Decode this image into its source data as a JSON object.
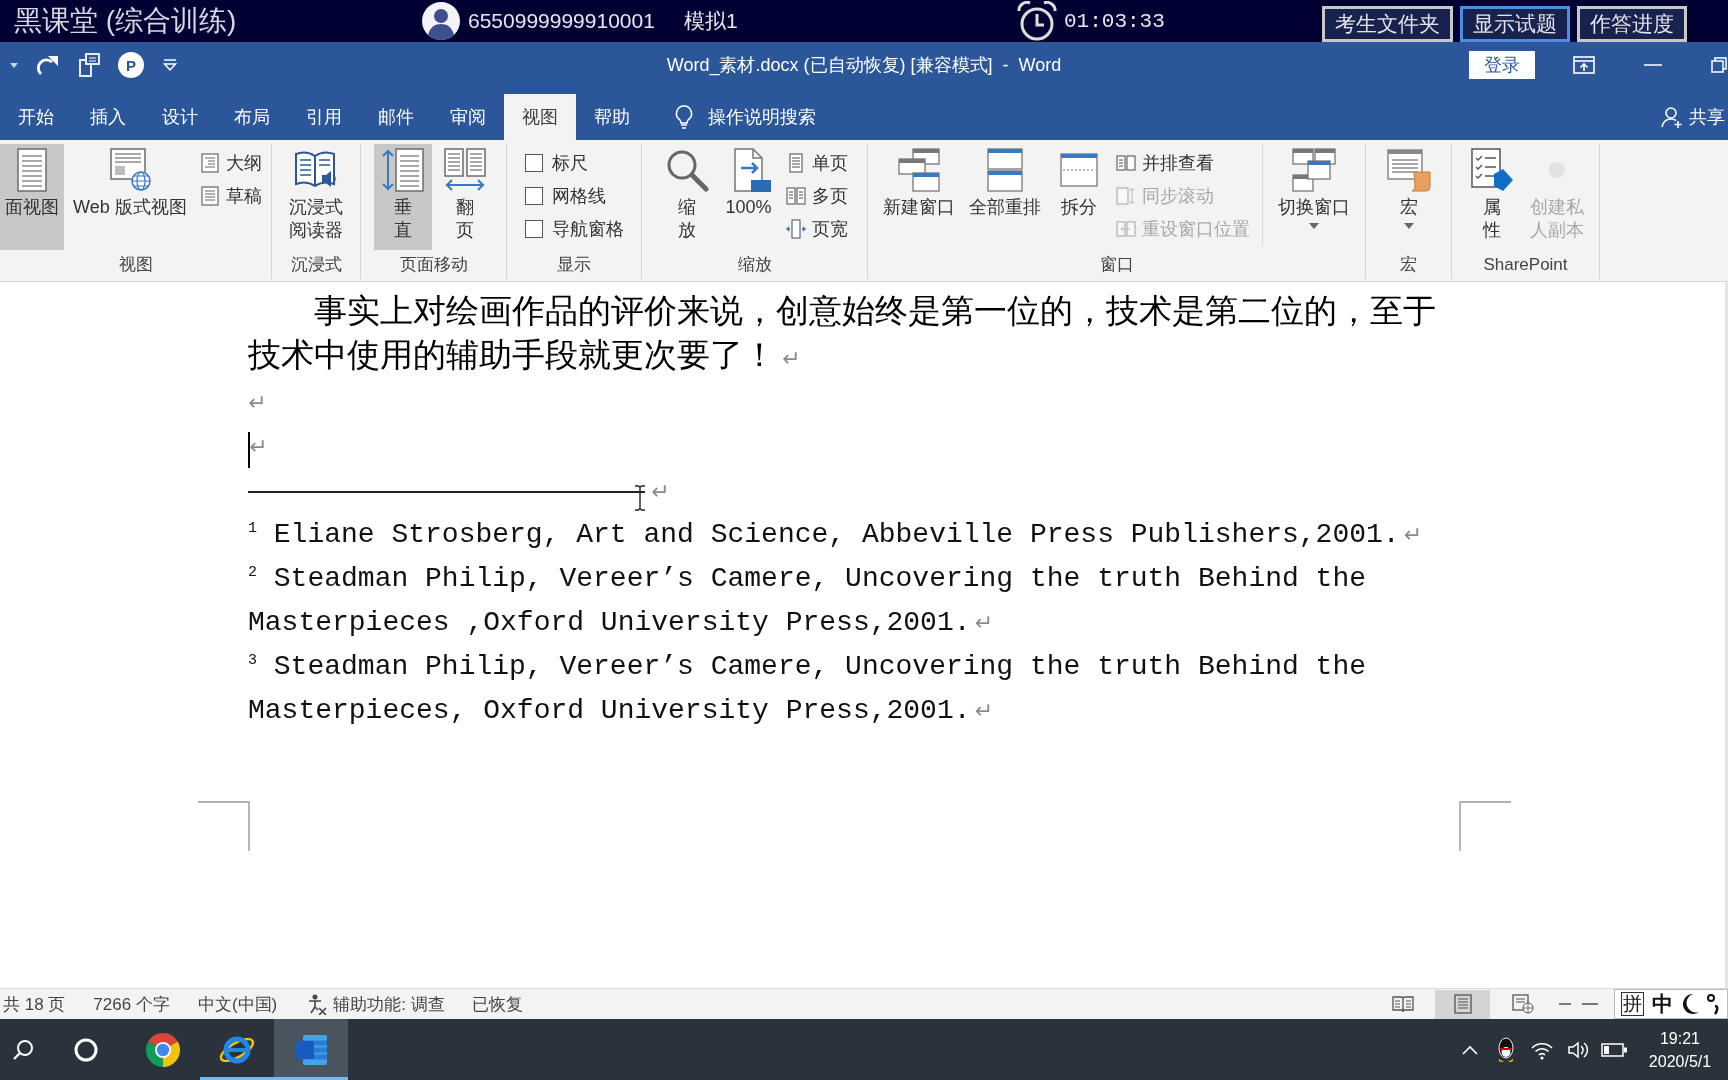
{
  "exam_bar": {
    "title": "黑课堂 (综合训练)",
    "candidate_id": "6550999999910001",
    "mode": "模拟1",
    "timer": "01:03:33",
    "buttons": [
      {
        "label": "考生文件夹",
        "selected": false
      },
      {
        "label": "显示试题",
        "selected": true
      },
      {
        "label": "作答进度",
        "selected": false
      }
    ]
  },
  "window": {
    "quick_access_badge": "P",
    "title": "Word_素材.docx (已自动恢复) [兼容模式]  -  Word",
    "sign_in": "登录"
  },
  "tabs": [
    {
      "label": "开始",
      "selected": false
    },
    {
      "label": "插入",
      "selected": false
    },
    {
      "label": "设计",
      "selected": false
    },
    {
      "label": "布局",
      "selected": false
    },
    {
      "label": "引用",
      "selected": false
    },
    {
      "label": "邮件",
      "selected": false
    },
    {
      "label": "审阅",
      "selected": false
    },
    {
      "label": "视图",
      "selected": true
    },
    {
      "label": "帮助",
      "selected": false
    }
  ],
  "tell_me": "操作说明搜索",
  "share": "共享",
  "ribbon": {
    "groups": [
      {
        "label": "视图",
        "items": [
          {
            "kind": "large",
            "label": "面视图",
            "selected": true
          },
          {
            "kind": "large",
            "label": "Web 版式视图",
            "selected": false
          },
          {
            "kind": "stack",
            "items": [
              {
                "kind": "small",
                "label": "大纲"
              },
              {
                "kind": "small",
                "label": "草稿"
              }
            ]
          }
        ]
      },
      {
        "label": "沉浸式",
        "items": [
          {
            "kind": "large",
            "label": "沉浸式阅读器"
          }
        ]
      },
      {
        "label": "页面移动",
        "items": [
          {
            "kind": "large",
            "label": "垂直",
            "selected": true
          },
          {
            "kind": "large",
            "label": "翻页",
            "selected": false
          }
        ]
      },
      {
        "label": "显示",
        "items": [
          {
            "kind": "stack",
            "items": [
              {
                "kind": "checkbox",
                "label": "标尺",
                "checked": false
              },
              {
                "kind": "checkbox",
                "label": "网格线",
                "checked": false
              },
              {
                "kind": "checkbox",
                "label": "导航窗格",
                "checked": false
              }
            ]
          }
        ]
      },
      {
        "label": "缩放",
        "items": [
          {
            "kind": "large",
            "label": "缩放"
          },
          {
            "kind": "large",
            "label": "100%"
          },
          {
            "kind": "stack",
            "items": [
              {
                "kind": "small",
                "label": "单页"
              },
              {
                "kind": "small",
                "label": "多页"
              },
              {
                "kind": "small",
                "label": "页宽"
              }
            ]
          }
        ]
      },
      {
        "label": "窗口",
        "items": [
          {
            "kind": "large",
            "label": "新建窗口"
          },
          {
            "kind": "large",
            "label": "全部重排"
          },
          {
            "kind": "large",
            "label": "拆分"
          },
          {
            "kind": "stack",
            "items": [
              {
                "kind": "small",
                "label": "并排查看",
                "disabled": false
              },
              {
                "kind": "small",
                "label": "同步滚动",
                "disabled": true
              },
              {
                "kind": "small",
                "label": "重设窗口位置",
                "disabled": true
              }
            ]
          },
          {
            "kind": "large",
            "label": "切换窗口",
            "dropdown": true
          }
        ]
      },
      {
        "label": "宏",
        "items": [
          {
            "kind": "large",
            "label": "宏",
            "dropdown": true
          }
        ]
      },
      {
        "label": "SharePoint",
        "items": [
          {
            "kind": "large",
            "label": "属性",
            "disabled": false
          },
          {
            "kind": "large",
            "label": "创建私人副本",
            "disabled": true
          }
        ]
      }
    ]
  },
  "document": {
    "paragraphs": [
      {
        "kind": "body",
        "text": "事实上对绘画作品的评价来说，创意始终是第一位的，技术是第二位的，至于技术中使用的辅助手段就更次要了！",
        "mark": "↵",
        "caret": false
      },
      {
        "kind": "empty",
        "mark": "↵",
        "caret": false
      },
      {
        "kind": "empty",
        "mark": "↵",
        "caret": true
      }
    ],
    "footnote_separator": {
      "mark": "↵"
    },
    "footnotes": [
      {
        "text": "$^{1}$ Eliane Strosberg, Art and Science, Abbeville Press Publishers,2001.",
        "mark": "↵"
      },
      {
        "text": "$^{2}$ Steadman Philip, Vereer’s Camere, Uncovering the truth Behind the Masterpieces ,Oxford University Press,2001.",
        "mark": "↵"
      },
      {
        "text": "$^{3}$ Steadman Philip, Vereer’s Camere, Uncovering the truth Behind the Masterpieces, Oxford University Press,2001.",
        "mark": "↵"
      }
    ]
  },
  "status_bar": {
    "page_count": "共 18 页",
    "word_count": "7266 个字",
    "language": "中文(中国)",
    "accessibility": "辅助功能: 调查",
    "recovery": "已恢复",
    "views": [
      {
        "selected": false
      },
      {
        "selected": true
      },
      {
        "selected": false
      }
    ]
  },
  "ime": {
    "mode": "拼",
    "language": "中"
  },
  "taskbar": {
    "apps": [
      {
        "running": false,
        "selected": false
      },
      {
        "running": true,
        "selected": false
      },
      {
        "running": true,
        "selected": true
      }
    ],
    "time": "19:21",
    "date": "2020/5/1"
  }
}
